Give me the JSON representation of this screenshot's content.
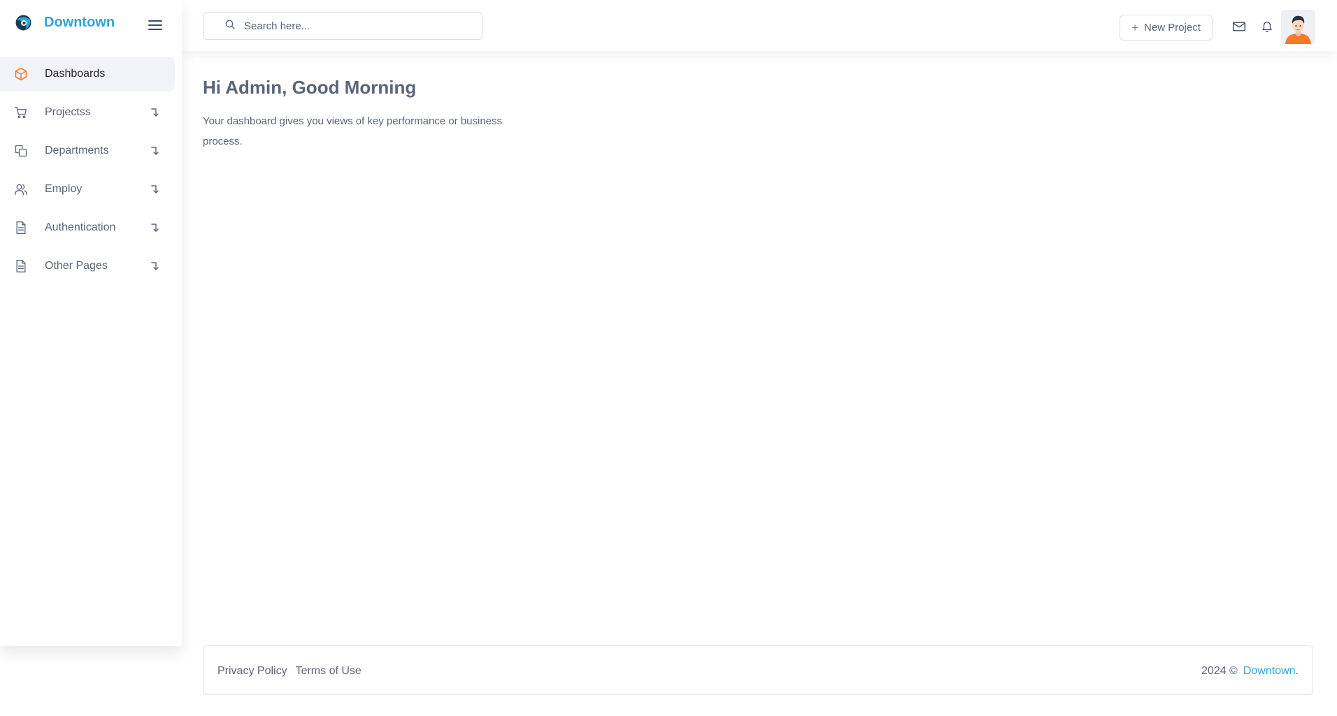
{
  "brand": {
    "name": "Downtown",
    "logo_icon": "eye-logo-icon",
    "color": "#2fa5d6"
  },
  "sidebar": {
    "items": [
      {
        "label": "Dashboards",
        "icon": "cube-icon",
        "active": true,
        "has_submenu": false
      },
      {
        "label": "Projectss",
        "icon": "cart-icon",
        "active": false,
        "has_submenu": true
      },
      {
        "label": "Departments",
        "icon": "copy-icon",
        "active": false,
        "has_submenu": true
      },
      {
        "label": "Employ",
        "icon": "users-icon",
        "active": false,
        "has_submenu": true
      },
      {
        "label": "Authentication",
        "icon": "document-icon",
        "active": false,
        "has_submenu": true
      },
      {
        "label": "Other Pages",
        "icon": "document-icon",
        "active": false,
        "has_submenu": true
      }
    ]
  },
  "header": {
    "search_placeholder": "Search here...",
    "new_project_label": "New Project"
  },
  "main": {
    "greeting": "Hi Admin, Good Morning",
    "subtitle": "Your dashboard gives you views of key performance or business process."
  },
  "footer": {
    "privacy_label": "Privacy Policy",
    "terms_label": "Terms of Use",
    "copyright": "2024 ©",
    "brand_link": "Downtown",
    "trailing": "."
  },
  "colors": {
    "accent": "#2fa5d6",
    "active_icon": "#f47a2c",
    "text": "#5b6478"
  }
}
